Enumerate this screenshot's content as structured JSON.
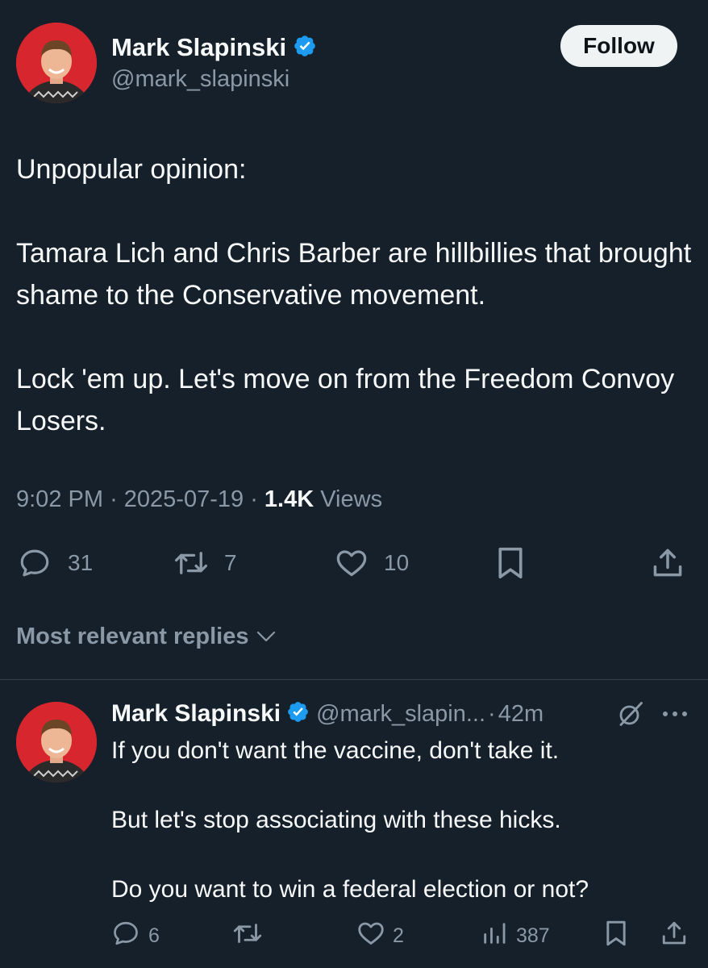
{
  "tweet": {
    "author_name": "Mark Slapinski",
    "author_handle": "@mark_slapinski",
    "follow_label": "Follow",
    "text": "Unpopular opinion:\n\nTamara Lich and Chris Barber are hillbillies that brought shame to the Conservative movement.\n\nLock 'em up. Let's move on from the Freedom Convoy Losers.",
    "time": "9:02 PM",
    "date": "2025-07-19",
    "views_count": "1.4K",
    "views_label": "Views",
    "replies": "31",
    "reposts": "7",
    "likes": "10"
  },
  "replies_header": {
    "label": "Most relevant replies"
  },
  "reply": {
    "author_name": "Mark Slapinski",
    "author_handle": "@mark_slapin...",
    "time": "42m",
    "text": "If you don't want the vaccine, don't take it.\n\nBut let's stop associating with these hicks.\n\nDo you want to win a federal election or not?",
    "replies": "6",
    "likes": "2",
    "views": "387"
  },
  "colors": {
    "background": "#15202b",
    "text": "#f7f9f9",
    "muted": "#8b98a5",
    "verified": "#1d9bf0",
    "divider": "#38444d"
  }
}
